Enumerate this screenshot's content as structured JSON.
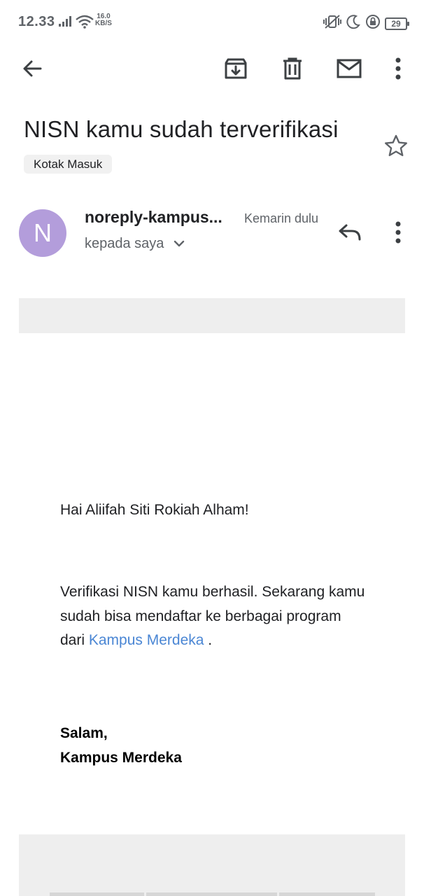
{
  "status_bar": {
    "time": "12.33",
    "speed_value": "16.0",
    "speed_unit": "KB/S",
    "battery": "29"
  },
  "toolbar": {
    "back_icon": "arrow-left-icon",
    "archive_icon": "archive-icon",
    "delete_icon": "trash-icon",
    "mark_unread_icon": "mail-icon",
    "more_icon": "more-vert-icon"
  },
  "email": {
    "subject": "NISN kamu sudah terverifikasi",
    "label": "Kotak Masuk",
    "sender": {
      "avatar_letter": "N",
      "avatar_color": "#b39ddb",
      "name": "noreply-kampus...",
      "date": "Kemarin dulu",
      "recipient": "kepada saya"
    },
    "body": {
      "greeting": "Hai Aliifah Siti Rokiah Alham!",
      "message_before_link": "Verifikasi NISN kamu berhasil. Sekarang kamu sudah bisa mendaftar ke berbagai program dari ",
      "link_text": "Kampus Merdeka",
      "message_after_link": " .",
      "link_color": "#4a86d4",
      "signoff_line1": "Salam,",
      "signoff_line2": "Kampus Merdeka"
    }
  }
}
